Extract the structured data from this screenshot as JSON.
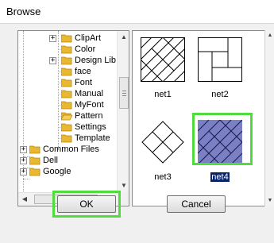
{
  "window": {
    "title": "Browse"
  },
  "tree": {
    "items": [
      {
        "label": "ClipArt",
        "expandable": true
      },
      {
        "label": "Color",
        "expandable": false
      },
      {
        "label": "Design Lib",
        "expandable": true
      },
      {
        "label": "face",
        "expandable": false
      },
      {
        "label": "Font",
        "expandable": false
      },
      {
        "label": "Manual",
        "expandable": false
      },
      {
        "label": "MyFont",
        "expandable": false
      },
      {
        "label": "Pattern",
        "expandable": false
      },
      {
        "label": "Settings",
        "expandable": false
      },
      {
        "label": "Template",
        "expandable": false
      },
      {
        "label": "Common Files",
        "expandable": true
      },
      {
        "label": "Dell",
        "expandable": true
      },
      {
        "label": "Google",
        "expandable": true
      }
    ],
    "hscroll_grip": "|||"
  },
  "patterns": {
    "items": [
      {
        "label": "net1",
        "icon": "net1-pattern-icon"
      },
      {
        "label": "net2",
        "icon": "net2-pattern-icon"
      },
      {
        "label": "net3",
        "icon": "net3-pattern-icon"
      },
      {
        "label": "net4",
        "icon": "net4-pattern-icon",
        "selected": true
      }
    ],
    "selected_fill": "#7b7fc4"
  },
  "buttons": {
    "ok": "OK",
    "cancel": "Cancel"
  },
  "colors": {
    "highlight": "#4fdc3c",
    "selection": "#0a246a",
    "folder": "#e8b830"
  }
}
